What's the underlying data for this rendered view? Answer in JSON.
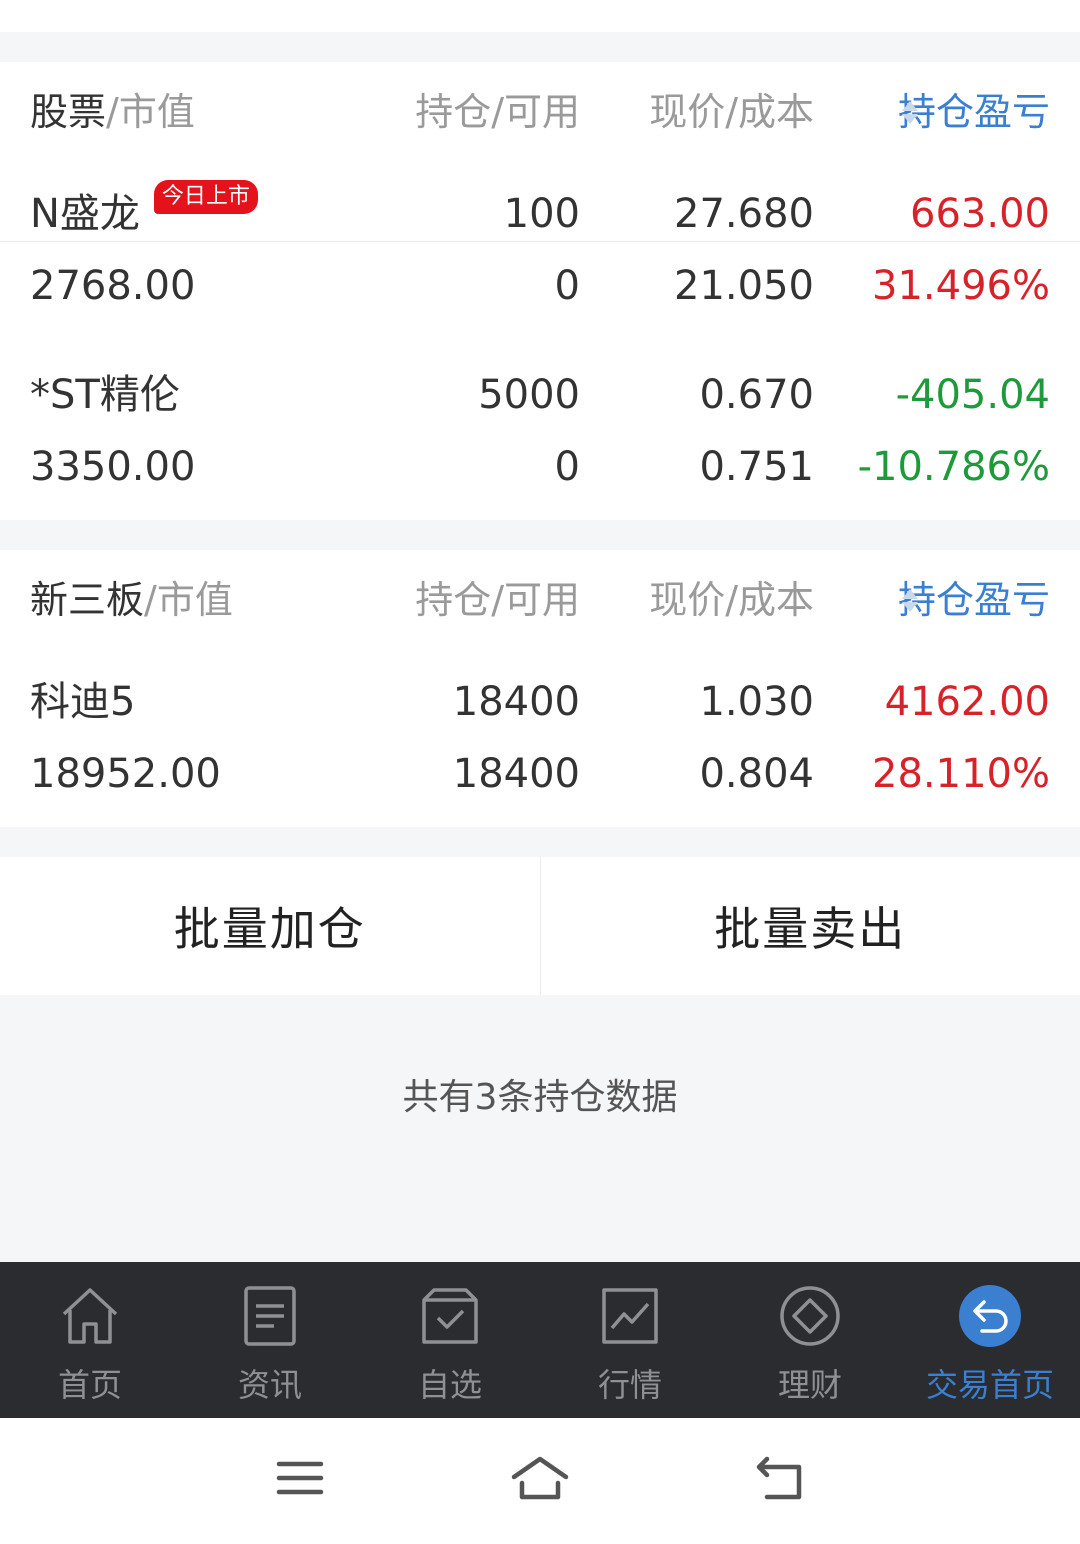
{
  "stocks_section": {
    "header": {
      "name": "股票",
      "name_suffix": "/市值",
      "position": "持仓/可用",
      "price": "现价/成本",
      "profit": "持仓盈亏"
    },
    "rows": [
      {
        "name": "N盛龙",
        "badge": "今日上市",
        "market_value": "2768.00",
        "holding": "100",
        "available": "0",
        "current_price": "27.680",
        "cost": "21.050",
        "profit": "663.00",
        "profit_pct": "31.496%",
        "trend": "up"
      },
      {
        "name": "*ST精伦",
        "market_value": "3350.00",
        "holding": "5000",
        "available": "0",
        "current_price": "0.670",
        "cost": "0.751",
        "profit": "-405.04",
        "profit_pct": "-10.786%",
        "trend": "down"
      }
    ]
  },
  "neeq_section": {
    "header": {
      "name": "新三板",
      "name_suffix": "/市值",
      "position": "持仓/可用",
      "price": "现价/成本",
      "profit": "持仓盈亏"
    },
    "rows": [
      {
        "name": "科迪5",
        "market_value": "18952.00",
        "holding": "18400",
        "available": "18400",
        "current_price": "1.030",
        "cost": "0.804",
        "profit": "4162.00",
        "profit_pct": "28.110%",
        "trend": "up"
      }
    ]
  },
  "actions": {
    "batch_add": "批量加仓",
    "batch_sell": "批量卖出"
  },
  "summary": "共有3条持仓数据",
  "tabbar": {
    "items": [
      {
        "label": "首页",
        "icon": "home-icon"
      },
      {
        "label": "资讯",
        "icon": "news-icon"
      },
      {
        "label": "自选",
        "icon": "watchlist-icon"
      },
      {
        "label": "行情",
        "icon": "market-chart-icon"
      },
      {
        "label": "理财",
        "icon": "finance-diamond-icon"
      },
      {
        "label": "交易首页",
        "icon": "trade-back-icon",
        "active": true
      }
    ]
  },
  "colors": {
    "up": "#d8222a",
    "down": "#1f9a3a",
    "accent": "#3a7fd0",
    "tabbar_bg": "#2b2c2f"
  }
}
